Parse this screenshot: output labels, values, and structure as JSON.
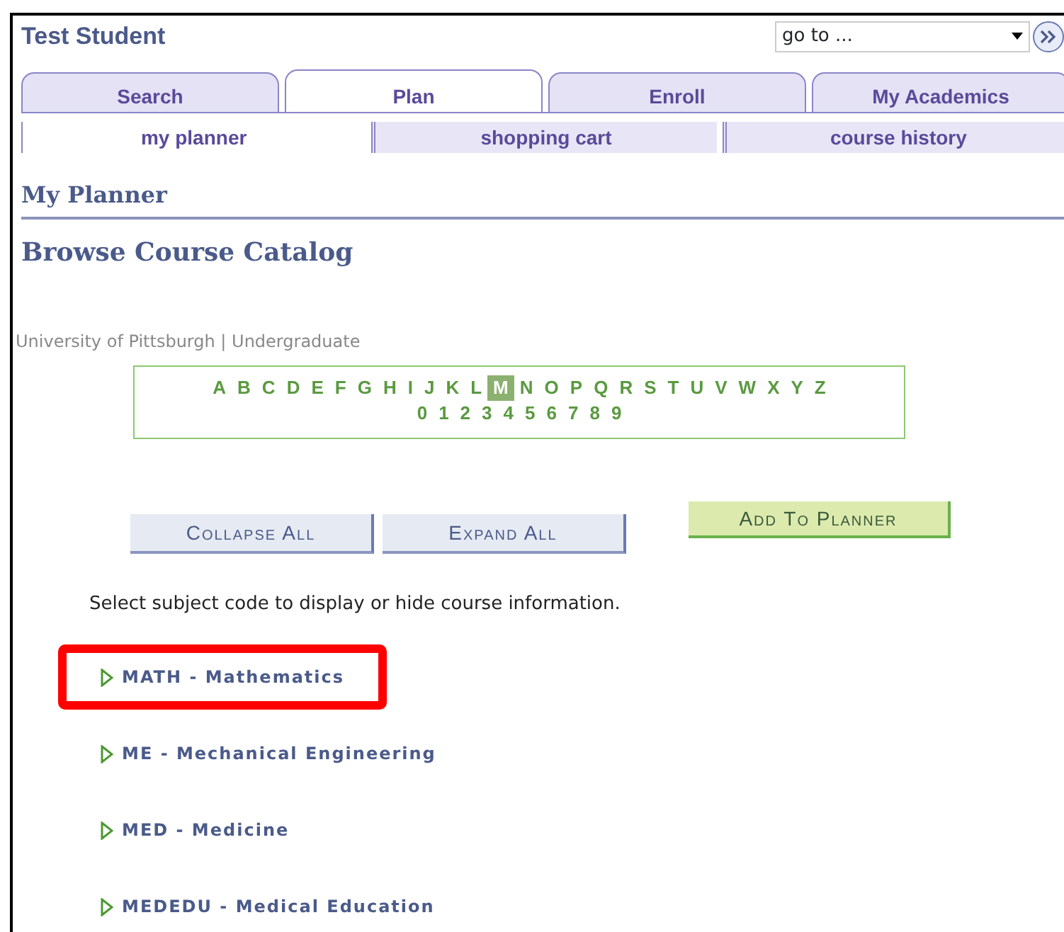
{
  "header": {
    "title": "Test Student",
    "goto": {
      "value": "go to ..."
    }
  },
  "tabs": [
    {
      "label": "Search",
      "selected": false
    },
    {
      "label": "Plan",
      "selected": true
    },
    {
      "label": "Enroll",
      "selected": false
    },
    {
      "label": "My Academics",
      "selected": false
    }
  ],
  "subtabs": [
    {
      "label": "my planner",
      "selected": true
    },
    {
      "label": "shopping cart",
      "selected": false
    },
    {
      "label": "course history",
      "selected": false
    }
  ],
  "page_title": "My Planner",
  "section_title": "Browse Course Catalog",
  "institution": "University of Pittsburgh | Undergraduate",
  "letters": [
    {
      "label": "A",
      "selected": false
    },
    {
      "label": "B",
      "selected": false
    },
    {
      "label": "C",
      "selected": false
    },
    {
      "label": "D",
      "selected": false
    },
    {
      "label": "E",
      "selected": false
    },
    {
      "label": "F",
      "selected": false
    },
    {
      "label": "G",
      "selected": false
    },
    {
      "label": "H",
      "selected": false
    },
    {
      "label": "I",
      "selected": false
    },
    {
      "label": "J",
      "selected": false
    },
    {
      "label": "K",
      "selected": false
    },
    {
      "label": "L",
      "selected": false
    },
    {
      "label": "M",
      "selected": true
    },
    {
      "label": "N",
      "selected": false
    },
    {
      "label": "O",
      "selected": false
    },
    {
      "label": "P",
      "selected": false
    },
    {
      "label": "Q",
      "selected": false
    },
    {
      "label": "R",
      "selected": false
    },
    {
      "label": "S",
      "selected": false
    },
    {
      "label": "T",
      "selected": false
    },
    {
      "label": "U",
      "selected": false
    },
    {
      "label": "V",
      "selected": false
    },
    {
      "label": "W",
      "selected": false
    },
    {
      "label": "X",
      "selected": false
    },
    {
      "label": "Y",
      "selected": false
    },
    {
      "label": "Z",
      "selected": false
    }
  ],
  "digits": [
    {
      "label": "0",
      "selected": false
    },
    {
      "label": "1",
      "selected": false
    },
    {
      "label": "2",
      "selected": false
    },
    {
      "label": "3",
      "selected": false
    },
    {
      "label": "4",
      "selected": false
    },
    {
      "label": "5",
      "selected": false
    },
    {
      "label": "6",
      "selected": false
    },
    {
      "label": "7",
      "selected": false
    },
    {
      "label": "8",
      "selected": false
    },
    {
      "label": "9",
      "selected": false
    }
  ],
  "buttons": [
    {
      "label": "Collapse All",
      "kind": "plain"
    },
    {
      "label": "Expand All",
      "kind": "plain"
    },
    {
      "label": "Add To Planner",
      "kind": "primary"
    }
  ],
  "instruction": "Select subject code to display or hide course information.",
  "subjects": [
    {
      "label": "MATH - Mathematics",
      "expanded": false,
      "highlighted": true
    },
    {
      "label": "ME - Mechanical Engineering",
      "expanded": false,
      "highlighted": false
    },
    {
      "label": "MED - Medicine",
      "expanded": false,
      "highlighted": false
    },
    {
      "label": "MEDEDU - Medical Education",
      "expanded": false,
      "highlighted": false
    }
  ]
}
